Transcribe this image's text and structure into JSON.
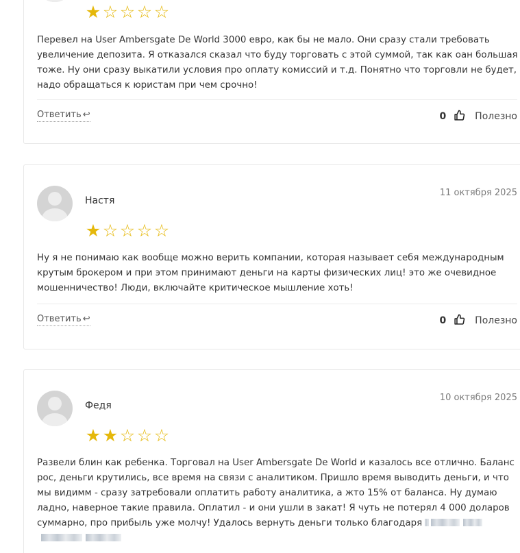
{
  "reviews": [
    {
      "author": "",
      "date": "",
      "rating": 1,
      "text": "Перевел на User Ambersgate De World 3000 евро, как бы не мало. Они сразу стали требовать увеличение депозита. Я отказался сказал что буду торговать с этой суммой, так как оан большая тоже. Ну они сразу выкатили условия про оплату комиссий и т.д. Понятно что торговли не будет, надо обращаться к юристам при чем срочно!",
      "reply_label": "Ответить",
      "useful_count": "0",
      "useful_label": "Полезно"
    },
    {
      "author": "Настя",
      "date": "11 октября 2025",
      "rating": 1,
      "text": "Ну я не понимаю как вообще можно верить компании, которая называет себя международным крутым брокером и при этом принимают деньги на карты физических лиц! это же очевидное мошенничество! Люди, включайте критическое мышление хоть!",
      "reply_label": "Ответить",
      "useful_count": "0",
      "useful_label": "Полезно"
    },
    {
      "author": "Федя",
      "date": "10 октября 2025",
      "rating": 2,
      "text": "Развели блин как ребенка. Торговал на User Ambersgate De World и казалось все отлично. Баланс рос, деньги крутились, все время на связи с аналитиком. Пришло время выводить деньги, и что мы видимм - сразу затребовали оплатить работу аналитика, а жто 15% от баланса. Ну думаю ладно, наверное такие правила. Оплатил - и они ушли в закат! Я чуть не потерял 4 000 доларов суммарно, про прибыль уже молчу! Удалось вернуть деньги только благодаря"
    }
  ],
  "icons": {
    "star_filled": "★",
    "star_empty": "☆",
    "reply_arrow": "↩",
    "thumb": "thumbs-up-icon"
  },
  "colors": {
    "star": "#e5b80b",
    "border": "#e8e8e8",
    "date": "#7a7a7a"
  }
}
